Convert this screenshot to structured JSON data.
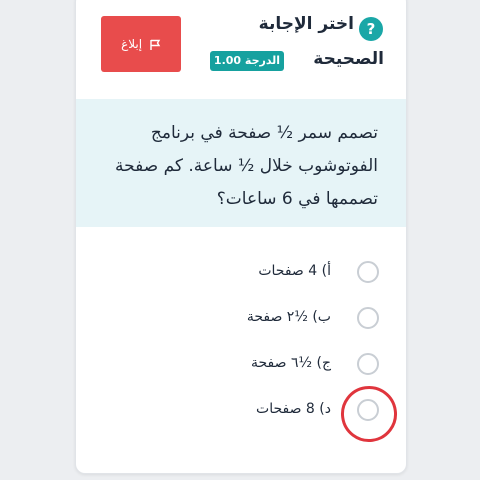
{
  "header": {
    "help_icon": "question-mark-icon",
    "title_line1": "اختر الإجابة",
    "title_line2": "الصحيحة",
    "grade_badge": "الدرجة 1.00",
    "report_label": "إبلاغ",
    "report_icon": "flag-icon"
  },
  "question": {
    "text": "تصمم سمر ½ صفحة في برنامج الفوتوشوب خلال ½ ساعة. كم صفحة تصممها في 6 ساعات؟"
  },
  "options": [
    {
      "label": "أ) 4 صفحات"
    },
    {
      "label": "ب) ½٢ صفحة"
    },
    {
      "label": "ج) ½٦ صفحة"
    },
    {
      "label": "د) 8 صفحات"
    }
  ],
  "colors": {
    "accent_teal": "#16a19f",
    "report_red": "#e84c4c",
    "question_bg": "#e6f4f7",
    "annotation_red": "#e0353d"
  }
}
